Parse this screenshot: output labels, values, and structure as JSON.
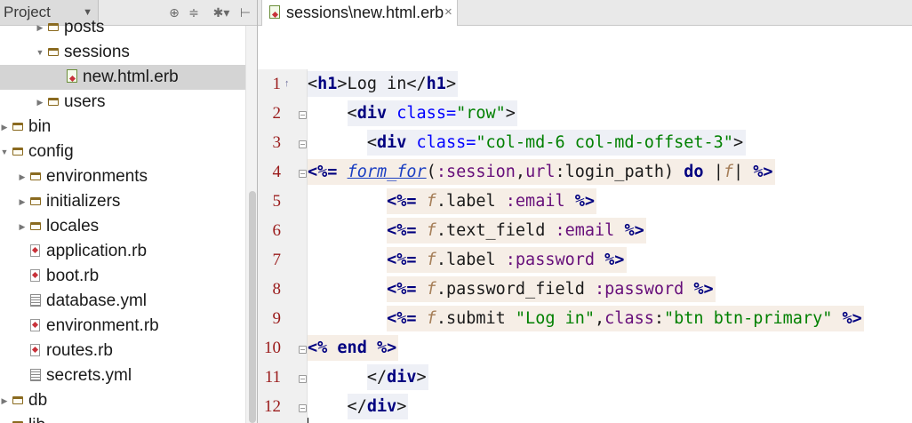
{
  "project_panel": {
    "selector_label": "Project",
    "tree": [
      {
        "label": "posts",
        "type": "folder",
        "level": 2,
        "expanded": false
      },
      {
        "label": "sessions",
        "type": "folder",
        "level": 2,
        "expanded": true
      },
      {
        "label": "new.html.erb",
        "type": "erb",
        "level": 3,
        "selected": true
      },
      {
        "label": "users",
        "type": "folder",
        "level": 2,
        "expanded": false
      },
      {
        "label": "bin",
        "type": "folder",
        "level": 0,
        "expanded": false
      },
      {
        "label": "config",
        "type": "folder",
        "level": 0,
        "expanded": true
      },
      {
        "label": "environments",
        "type": "folder",
        "level": 1,
        "expanded": false
      },
      {
        "label": "initializers",
        "type": "folder",
        "level": 1,
        "expanded": false
      },
      {
        "label": "locales",
        "type": "folder",
        "level": 1,
        "expanded": false
      },
      {
        "label": "application.rb",
        "type": "ruby",
        "level": 1
      },
      {
        "label": "boot.rb",
        "type": "ruby",
        "level": 1
      },
      {
        "label": "database.yml",
        "type": "yml",
        "level": 1
      },
      {
        "label": "environment.rb",
        "type": "ruby",
        "level": 1
      },
      {
        "label": "routes.rb",
        "type": "ruby",
        "level": 1
      },
      {
        "label": "secrets.yml",
        "type": "yml",
        "level": 1
      },
      {
        "label": "db",
        "type": "folder",
        "level": 0,
        "expanded": false
      },
      {
        "label": "lib",
        "type": "folder",
        "level": 0,
        "expanded": false
      }
    ],
    "header_icons": [
      "target-icon",
      "collapse-icon",
      "gear-icon",
      "hide-panel-icon"
    ]
  },
  "editor": {
    "tab_label": "sessions\\new.html.erb",
    "line_numbers": [
      "1",
      "2",
      "3",
      "4",
      "5",
      "6",
      "7",
      "8",
      "9",
      "10",
      "11",
      "12"
    ],
    "lines": [
      [
        {
          "c": "tb",
          "v": "<"
        },
        {
          "c": "t",
          "v": "h1"
        },
        {
          "c": "tb",
          "v": ">Log in</"
        },
        {
          "c": "t",
          "v": "h1"
        },
        {
          "c": "tb",
          "v": ">"
        }
      ],
      [
        {
          "c": "tb",
          "v": "    <"
        },
        {
          "c": "t",
          "v": "div "
        },
        {
          "c": "an",
          "v": "class="
        },
        {
          "c": "av",
          "v": "\"row\""
        },
        {
          "c": "tb",
          "v": ">"
        }
      ],
      [
        {
          "c": "tb",
          "v": "      <"
        },
        {
          "c": "t",
          "v": "div "
        },
        {
          "c": "an",
          "v": "class="
        },
        {
          "c": "av",
          "v": "\"col-md-6 col-md-offset-3\""
        },
        {
          "c": "tb",
          "v": ">"
        }
      ],
      [
        {
          "c": "erb",
          "v": "<%= "
        },
        {
          "c": "link",
          "v": "form_for"
        },
        {
          "c": "mth",
          "v": "("
        },
        {
          "c": "sym",
          "v": ":session"
        },
        {
          "c": "mth",
          "v": ","
        },
        {
          "c": "sym",
          "v": "url"
        },
        {
          "c": "mth",
          "v": ":login_path) "
        },
        {
          "c": "kw",
          "v": "do"
        },
        {
          "c": "mth",
          "v": " |"
        },
        {
          "c": "var",
          "v": "f"
        },
        {
          "c": "mth",
          "v": "| "
        },
        {
          "c": "erb",
          "v": "%>"
        }
      ],
      [
        {
          "c": "tb",
          "v": "        "
        },
        {
          "c": "erb",
          "v": "<%= "
        },
        {
          "c": "var",
          "v": "f"
        },
        {
          "c": "mth",
          "v": ".label "
        },
        {
          "c": "sym",
          "v": ":email "
        },
        {
          "c": "erb",
          "v": "%>"
        }
      ],
      [
        {
          "c": "tb",
          "v": "        "
        },
        {
          "c": "erb",
          "v": "<%= "
        },
        {
          "c": "var",
          "v": "f"
        },
        {
          "c": "mth",
          "v": ".text_field "
        },
        {
          "c": "sym",
          "v": ":email "
        },
        {
          "c": "erb",
          "v": "%>"
        }
      ],
      [
        {
          "c": "tb",
          "v": "        "
        },
        {
          "c": "erb",
          "v": "<%= "
        },
        {
          "c": "var",
          "v": "f"
        },
        {
          "c": "mth",
          "v": ".label "
        },
        {
          "c": "sym",
          "v": ":password "
        },
        {
          "c": "erb",
          "v": "%>"
        }
      ],
      [
        {
          "c": "tb",
          "v": "        "
        },
        {
          "c": "erb",
          "v": "<%= "
        },
        {
          "c": "var",
          "v": "f"
        },
        {
          "c": "mth",
          "v": ".password_field "
        },
        {
          "c": "sym",
          "v": ":password "
        },
        {
          "c": "erb",
          "v": "%>"
        }
      ],
      [
        {
          "c": "tb",
          "v": "        "
        },
        {
          "c": "erb",
          "v": "<%= "
        },
        {
          "c": "var",
          "v": "f"
        },
        {
          "c": "mth",
          "v": ".submit "
        },
        {
          "c": "str",
          "v": "\"Log in\""
        },
        {
          "c": "mth",
          "v": ","
        },
        {
          "c": "sym",
          "v": "class"
        },
        {
          "c": "mth",
          "v": ":"
        },
        {
          "c": "str",
          "v": "\"btn btn-primary\""
        },
        {
          "c": "erb",
          "v": " %>"
        }
      ],
      [
        {
          "c": "erb",
          "v": "<% "
        },
        {
          "c": "kw",
          "v": "end"
        },
        {
          "c": "erb",
          "v": " %>"
        }
      ],
      [
        {
          "c": "tb",
          "v": "      </"
        },
        {
          "c": "t",
          "v": "div"
        },
        {
          "c": "tb",
          "v": ">"
        }
      ],
      [
        {
          "c": "tb",
          "v": "    </"
        },
        {
          "c": "t",
          "v": "div"
        },
        {
          "c": "tb",
          "v": ">"
        }
      ]
    ]
  },
  "colors": {
    "tag_name": "#000080",
    "attr_name": "#0000ff",
    "attr_value": "#008000",
    "symbol": "#660e7a",
    "block_var": "#a67f59",
    "erb_highlight": "#f6eee6",
    "tag_highlight": "#eef0f6",
    "line_number": "#9a1b1b"
  }
}
